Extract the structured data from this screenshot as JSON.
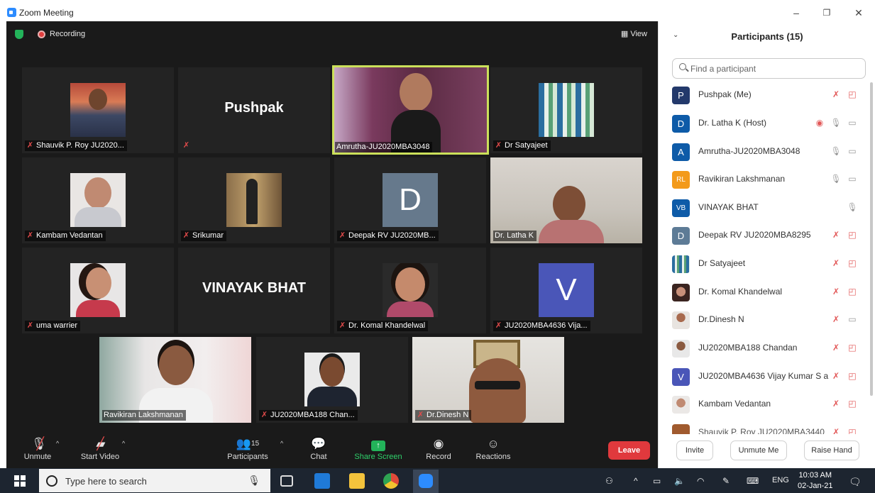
{
  "window": {
    "title": "Zoom Meeting",
    "minimize": "–",
    "restore": "❐",
    "close": "✕"
  },
  "meeting": {
    "recording_label": "Recording",
    "view_label": "View",
    "tiles": [
      {
        "name": "Shauvik P. Roy JU2020...",
        "muted": true,
        "kind": "photo"
      },
      {
        "name": "",
        "muted": true,
        "kind": "text",
        "display_name": "Pushpak"
      },
      {
        "name": "Amrutha-JU2020MBA3048",
        "muted": false,
        "kind": "video",
        "active_speaker": true
      },
      {
        "name": "Dr Satyajeet",
        "muted": true,
        "kind": "photo"
      },
      {
        "name": "Kambam Vedantan",
        "muted": true,
        "kind": "photo"
      },
      {
        "name": "Srikumar",
        "muted": true,
        "kind": "photo"
      },
      {
        "name": "Deepak RV JU2020MB...",
        "muted": true,
        "kind": "letter",
        "letter": "D"
      },
      {
        "name": "Dr. Latha K",
        "muted": false,
        "kind": "video"
      },
      {
        "name": "uma warrier",
        "muted": true,
        "kind": "photo"
      },
      {
        "name": "",
        "muted": false,
        "kind": "text",
        "display_name": "VINAYAK BHAT"
      },
      {
        "name": "Dr. Komal Khandelwal",
        "muted": true,
        "kind": "photo"
      },
      {
        "name": "JU2020MBA4636 Vija...",
        "muted": true,
        "kind": "letter",
        "letter": "V"
      },
      {
        "name": "Ravikiran Lakshmanan",
        "muted": false,
        "kind": "video"
      },
      {
        "name": "JU2020MBA188 Chan...",
        "muted": true,
        "kind": "photo"
      },
      {
        "name": "Dr.Dinesh N",
        "muted": true,
        "kind": "video"
      }
    ],
    "controls": {
      "unmute": "Unmute",
      "start_video": "Start Video",
      "participants": "Participants",
      "participants_count": "15",
      "chat": "Chat",
      "share_screen": "Share Screen",
      "record": "Record",
      "reactions": "Reactions",
      "leave": "Leave"
    }
  },
  "panel": {
    "title": "Participants (15)",
    "search_placeholder": "Find a participant",
    "participants": [
      {
        "name": "Pushpak (Me)",
        "initials": "P",
        "avatar_color": "#23396b",
        "mic": "muted",
        "video": "off"
      },
      {
        "name": "Dr. Latha K (Host)",
        "initials": "D",
        "avatar_color": "#0e5ba8",
        "mic": "on",
        "video": "on",
        "recording": true
      },
      {
        "name": "Amrutha-JU2020MBA3048",
        "initials": "A",
        "avatar_color": "#0e5ba8",
        "mic": "on",
        "video": "on"
      },
      {
        "name": "Ravikiran Lakshmanan",
        "initials": "RL",
        "avatar_color": "#f39a1a",
        "mic": "on",
        "video": "on"
      },
      {
        "name": "VINAYAK BHAT",
        "initials": "VB",
        "avatar_color": "#0e5ba8",
        "mic": "on",
        "video": "none"
      },
      {
        "name": "Deepak RV JU2020MBA8295",
        "initials": "D",
        "avatar_color": "#5d7b96",
        "mic": "muted",
        "video": "off"
      },
      {
        "name": "Dr Satyajeet",
        "initials": "",
        "avatar_color": "#6aa58a",
        "mic": "muted",
        "video": "off"
      },
      {
        "name": "Dr. Komal Khandelwal",
        "initials": "",
        "avatar_color": "#4a3530",
        "mic": "muted",
        "video": "off"
      },
      {
        "name": "Dr.Dinesh N",
        "initials": "",
        "avatar_color": "#d8c8c0",
        "mic": "muted",
        "video": "on"
      },
      {
        "name": "JU2020MBA188 Chandan",
        "initials": "",
        "avatar_color": "#3a4050",
        "mic": "muted",
        "video": "off"
      },
      {
        "name": "JU2020MBA4636 Vijay Kumar S a",
        "initials": "V",
        "avatar_color": "#4a56b8",
        "mic": "muted",
        "video": "off"
      },
      {
        "name": "Kambam Vedantan",
        "initials": "",
        "avatar_color": "#c9b6a9",
        "mic": "muted",
        "video": "off"
      },
      {
        "name": "Shauvik P. Roy JU2020MBA3440",
        "initials": "",
        "avatar_color": "#a05a2e",
        "mic": "muted",
        "video": "off"
      }
    ],
    "invite": "Invite",
    "unmute_me": "Unmute Me",
    "raise_hand": "Raise Hand"
  },
  "taskbar": {
    "search_text": "Type here to search",
    "language": "ENG",
    "time": "10:03 AM",
    "date": "02-Jan-21"
  }
}
